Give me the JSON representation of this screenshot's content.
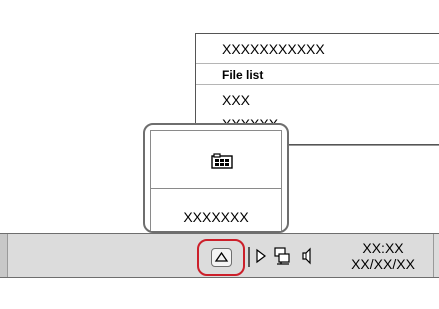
{
  "menu": {
    "items": [
      {
        "label": "XXXXXXXXXXX",
        "selected": false
      },
      {
        "label": "File list",
        "selected": true
      },
      {
        "label": "XXX",
        "selected": false
      },
      {
        "label": "XXXXXX",
        "selected": false
      }
    ]
  },
  "popup": {
    "icon": "filmstrip-icon",
    "label": "XXXXXXX"
  },
  "taskbar": {
    "chevron_icon": "chevron-up-icon",
    "tray_icons": [
      "pen-icon",
      "network-icon",
      "speaker-icon"
    ],
    "clock_time": "XX:XX",
    "clock_date": "XX/XX/XX"
  },
  "colors": {
    "highlight": "#cc1f2a",
    "taskbar_bg": "#dcdcdc",
    "border": "#6e6e6e"
  }
}
